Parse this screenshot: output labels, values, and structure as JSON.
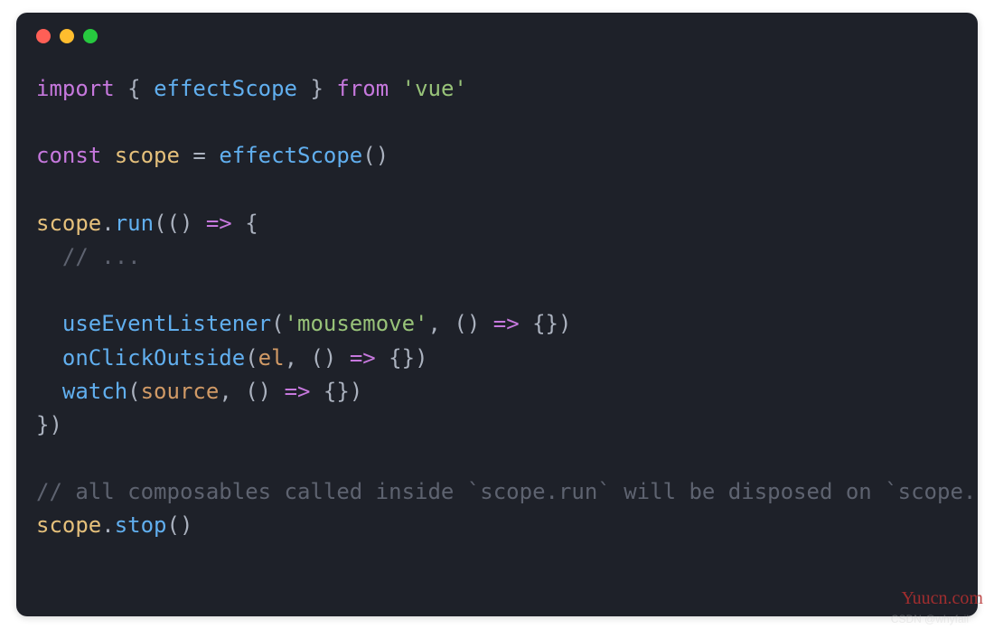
{
  "colors": {
    "background": "#1e2129",
    "red_dot": "#ff5f56",
    "yellow_dot": "#ffbd2e",
    "green_dot": "#27c93f"
  },
  "code": {
    "line1": {
      "import": "import",
      "lbrace": " { ",
      "name": "effectScope",
      "rbrace": " } ",
      "from": "from",
      "space": " ",
      "module": "'vue'"
    },
    "line3": {
      "const": "const",
      "space1": " ",
      "var": "scope",
      "assign": " = ",
      "fn": "effectScope",
      "parens": "()"
    },
    "line5": {
      "obj": "scope",
      "dot": ".",
      "method": "run",
      "open": "(() ",
      "arrow": "=>",
      "brace": " {"
    },
    "line6": {
      "indent": "  ",
      "comment": "// ..."
    },
    "line8": {
      "indent": "  ",
      "fn": "useEventListener",
      "open": "(",
      "str": "'mousemove'",
      "comma": ", () ",
      "arrow": "=>",
      "rest": " {})"
    },
    "line9": {
      "indent": "  ",
      "fn": "onClickOutside",
      "open": "(",
      "arg": "el",
      "comma": ", () ",
      "arrow": "=>",
      "rest": " {})"
    },
    "line10": {
      "indent": "  ",
      "fn": "watch",
      "open": "(",
      "arg": "source",
      "comma": ", () ",
      "arrow": "=>",
      "rest": " {})"
    },
    "line11": {
      "close": "})"
    },
    "line13": {
      "comment": "// all composables called inside `scope.run` will be disposed on `scope.stop()`"
    },
    "line14": {
      "obj": "scope",
      "dot": ".",
      "method": "stop",
      "parens": "()"
    }
  },
  "watermark_right": "Yuucn.com",
  "watermark_bottom": "CSDN @whyfail"
}
